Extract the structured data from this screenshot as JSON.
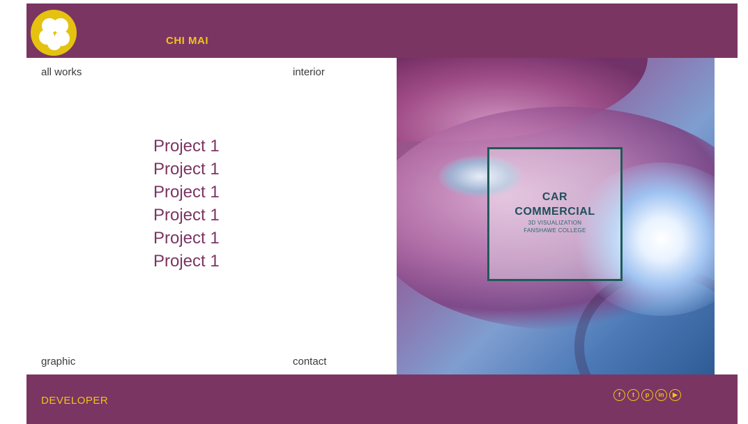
{
  "header": {
    "brand": "CHI MAI"
  },
  "nav": {
    "all_works": "all works",
    "interior": "interior",
    "graphic": "graphic",
    "contact": "contact"
  },
  "projects": [
    "Project 1",
    "Project 1",
    "Project 1",
    "Project 1",
    "Project 1",
    "Project 1"
  ],
  "hero": {
    "title_line1": "CAR",
    "title_line2": "COMMERCIAL",
    "subtitle_line1": "3D VISUALIZATION",
    "subtitle_line2": "FANSHAWE COLLEGE"
  },
  "footer": {
    "label": "DEVELOPER",
    "socials": [
      {
        "name": "facebook-icon",
        "glyph": "f"
      },
      {
        "name": "twitter-icon",
        "glyph": "t"
      },
      {
        "name": "pinterest-icon",
        "glyph": "p"
      },
      {
        "name": "linkedin-icon",
        "glyph": "in"
      },
      {
        "name": "youtube-icon",
        "glyph": "▶"
      }
    ]
  },
  "colors": {
    "brand_purple": "#7b3562",
    "accent_yellow": "#f0c419",
    "caption_teal": "#1f5a57"
  }
}
